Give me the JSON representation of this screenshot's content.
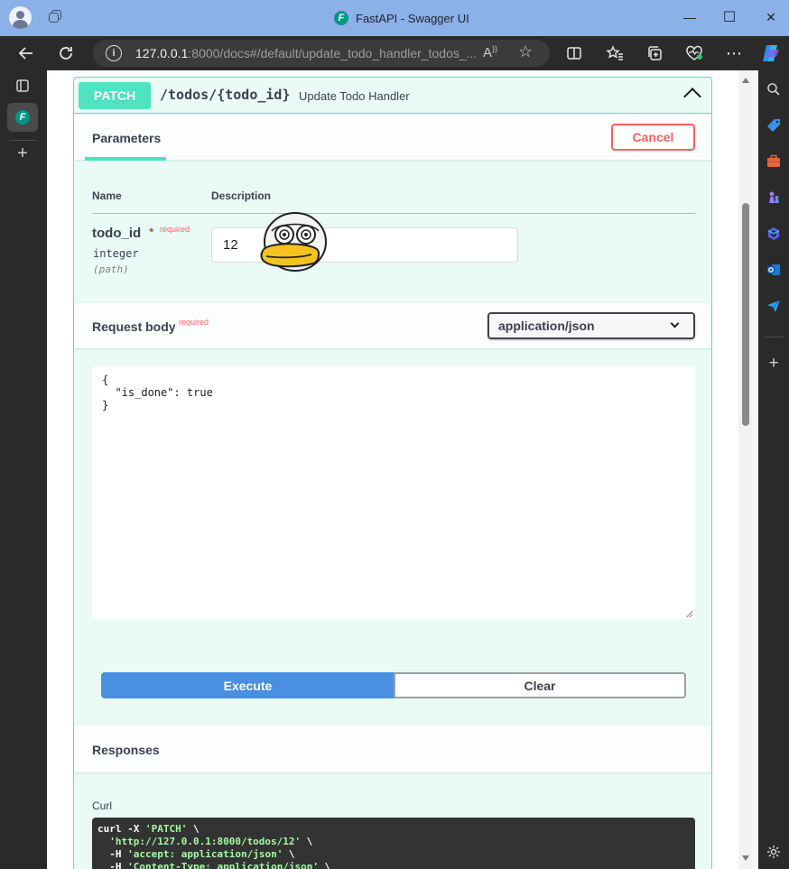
{
  "window": {
    "title": "FastAPI - Swagger UI",
    "favicon_letter": "F",
    "minimize": "—",
    "maximize": "☐",
    "close": "✕"
  },
  "browser": {
    "url_host": "127.0.0.1",
    "url_rest": ":8000/docs#/default/update_todo_handler_todos_...",
    "read_aloud": "A̩",
    "info": "i"
  },
  "operation": {
    "method": "PATCH",
    "path": "/todos/{todo_id}",
    "summary": "Update Todo Handler",
    "tab_parameters": "Parameters",
    "cancel_label": "Cancel",
    "col_name": "Name",
    "col_description": "Description",
    "param": {
      "name": "todo_id",
      "required_star": "*",
      "required_label": "required",
      "type": "integer",
      "location": "(path)",
      "value": "12"
    },
    "request_body": {
      "title": "Request body",
      "required_label": "required",
      "content_type": "application/json",
      "body": "{\n  \"is_done\": true\n}"
    },
    "execute_label": "Execute",
    "clear_label": "Clear",
    "responses_title": "Responses",
    "curl_label": "Curl",
    "curl": {
      "line1_cmd": "curl -X ",
      "line1_str": "'PATCH'",
      "line1_end": " \\",
      "line2_str": "  'http://127.0.0.1:8000/todos/12'",
      "line2_end": " \\",
      "line3_cmd": "  -H ",
      "line3_str": "'accept: application/json'",
      "line3_end": " \\",
      "line4_cmd": "  -H ",
      "line4_str": "'Content-Type: application/json'",
      "line4_end": " \\"
    }
  }
}
